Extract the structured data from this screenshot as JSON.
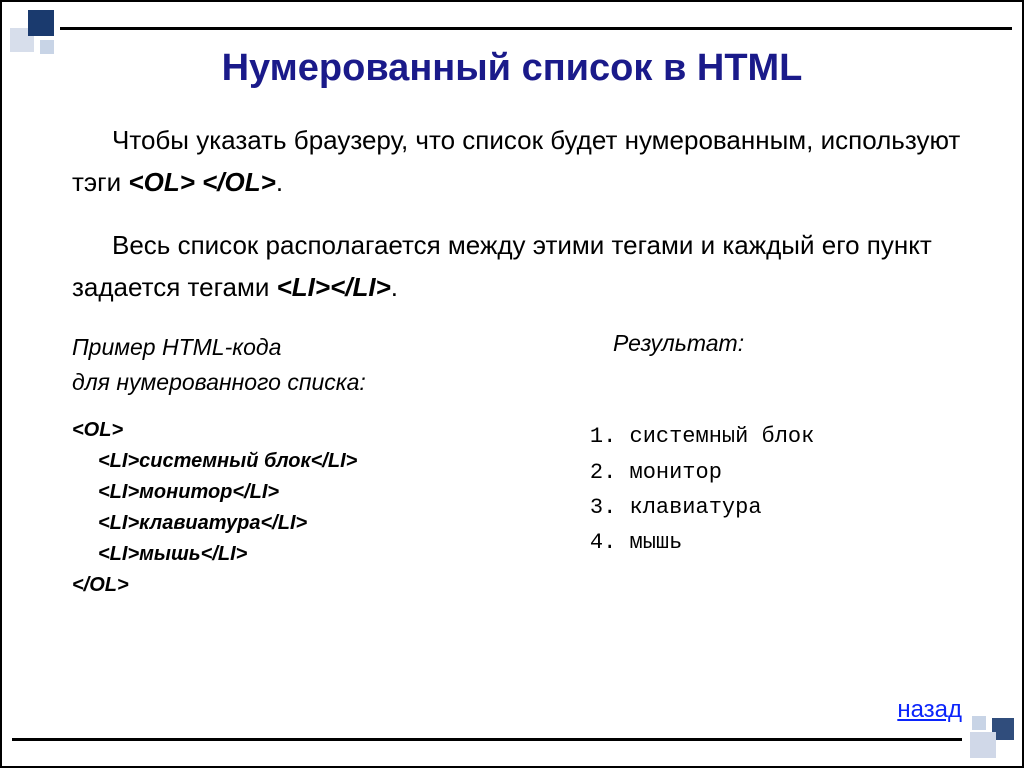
{
  "title": "Нумерованный список в HTML",
  "paragraph1_a": "Чтобы указать браузеру, что список будет нумерованным, используют тэги ",
  "paragraph1_ol_open": "<OL>",
  "paragraph1_space": " ",
  "paragraph1_ol_close": "</OL>",
  "paragraph1_dot": ".",
  "paragraph2_a": "Весь список располагается между этими тегами и каждый его пункт задается тегами ",
  "paragraph2_li_open": "<LI>",
  "paragraph2_li_close": "</LI>",
  "paragraph2_dot": ".",
  "subhead_left_line1": "Пример HTML-кода",
  "subhead_left_line2": "для нумерованного списка:",
  "subhead_right": "Результат:",
  "code": {
    "ol_open": "<OL>",
    "li1": "<LI>системный блок</LI>",
    "li2": "<LI>монитор</LI>",
    "li3": "<LI>клавиатура</LI>",
    "li4": "<LI>мышь</LI>",
    "ol_close": "</OL>"
  },
  "result_items": {
    "i1": "системный блок",
    "i2": "монитор",
    "i3": "клавиатура",
    "i4": "мышь"
  },
  "back": "назад"
}
